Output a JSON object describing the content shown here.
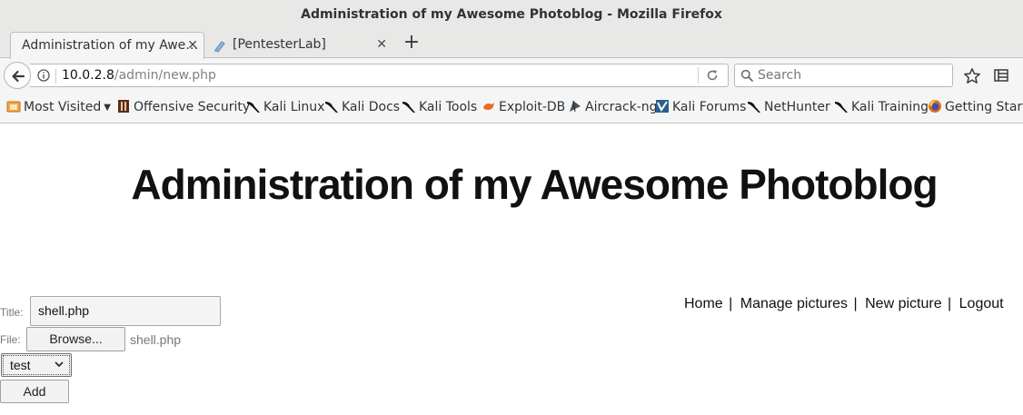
{
  "window": {
    "title": "Administration of my Awesome Photoblog - Mozilla Firefox"
  },
  "tabs": [
    {
      "label": "Administration of my Awe…",
      "active": true
    },
    {
      "label": "[PentesterLab]",
      "active": false
    }
  ],
  "toolbar": {
    "url_host": "10.0.2.8",
    "url_path": "/admin/new.php",
    "search_placeholder": "Search"
  },
  "bookmarks": [
    {
      "label": "Most Visited",
      "icon": "folder-icon"
    },
    {
      "label": "Offensive Security",
      "icon": "offsec-icon"
    },
    {
      "label": "Kali Linux",
      "icon": "kali-dragon-icon"
    },
    {
      "label": "Kali Docs",
      "icon": "kali-dragon-icon"
    },
    {
      "label": "Kali Tools",
      "icon": "kali-dragon-icon"
    },
    {
      "label": "Exploit-DB",
      "icon": "exploit-db-icon"
    },
    {
      "label": "Aircrack-ng",
      "icon": "aircrack-icon"
    },
    {
      "label": "Kali Forums",
      "icon": "kali-forums-icon"
    },
    {
      "label": "NetHunter",
      "icon": "kali-dragon-icon"
    },
    {
      "label": "Kali Training",
      "icon": "kali-dragon-icon"
    },
    {
      "label": "Getting Starte",
      "icon": "firefox-icon"
    }
  ],
  "page": {
    "title": "Administration of my Awesome Photoblog",
    "nav": {
      "home": "Home",
      "manage": "Manage pictures",
      "new": "New picture",
      "logout": "Logout",
      "separator": "|"
    },
    "form": {
      "title_label": "Title:",
      "title_value": "shell.php",
      "file_label": "File:",
      "browse_label": "Browse...",
      "file_name": "shell.php",
      "category_selected": "test",
      "submit_label": "Add"
    }
  },
  "colors": {
    "chrome_bg": "#e8e8e7",
    "toolbar_bg": "#f5f5f5",
    "page_text": "#111111",
    "muted_text": "#777777"
  }
}
